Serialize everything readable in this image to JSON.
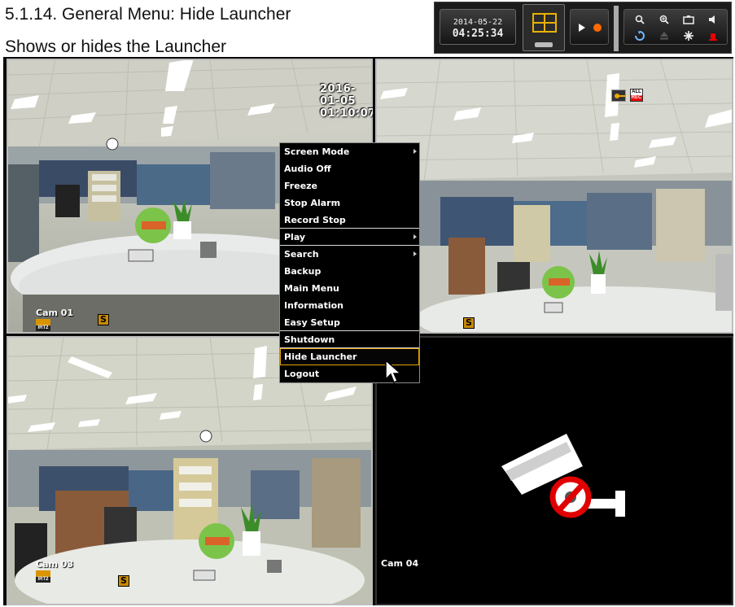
{
  "doc": {
    "title": "5.1.14. General Menu: Hide Launcher",
    "subtitle": "Shows or hides the Launcher"
  },
  "launcher": {
    "date": "2014-05-22",
    "time": "04:25:34",
    "icons": [
      "layout-grid-icon",
      "play-icon",
      "record-dot-icon",
      "search-icon",
      "zoom-icon",
      "camera-icon",
      "volume-icon",
      "ptz-icon",
      "eject-icon",
      "settings-icon",
      "alarm-icon"
    ]
  },
  "cameras": {
    "cam1": {
      "label": "Cam 01",
      "timestamp": "2016-01-05 01:10:07",
      "status_badge": "S",
      "irt_text": "IRT2"
    },
    "cam2": {
      "status_badge": "S",
      "rec_top": "ALL",
      "rec_bottom": "REC"
    },
    "cam3": {
      "label": "Cam 03",
      "status_badge": "S",
      "irt_text": "IRT2"
    },
    "cam4": {
      "label": "Cam 04",
      "icon": "no-camera-icon"
    }
  },
  "menu": {
    "items": [
      {
        "label": "Screen Mode",
        "submenu": true
      },
      {
        "label": "Audio Off"
      },
      {
        "label": "Freeze"
      },
      {
        "label": "Stop Alarm"
      },
      {
        "label": "Record Stop"
      },
      {
        "label": "Play",
        "submenu": true
      },
      {
        "label": "Search",
        "submenu": true
      },
      {
        "label": "Backup"
      },
      {
        "label": "Main Menu"
      },
      {
        "label": "Information"
      },
      {
        "label": "Easy Setup"
      },
      {
        "label": "Shutdown"
      },
      {
        "label": "Hide Launcher",
        "selected": true
      },
      {
        "label": "Logout"
      }
    ]
  },
  "colors": {
    "accent": "#e3a400",
    "menu_bg": "#000000",
    "grid_bg": "#0a0a0a"
  }
}
